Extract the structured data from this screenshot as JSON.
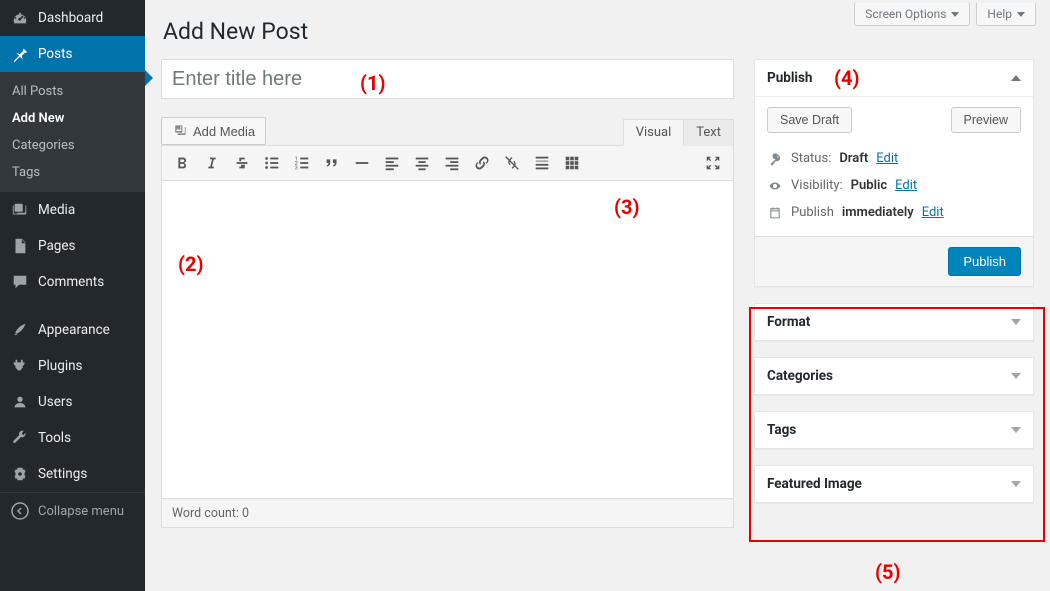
{
  "screen_options": {
    "label": "Screen Options",
    "help_label": "Help"
  },
  "page": {
    "title": "Add New Post"
  },
  "sidebar": {
    "items": [
      {
        "label": "Dashboard"
      },
      {
        "label": "Posts"
      },
      {
        "label": "Media"
      },
      {
        "label": "Pages"
      },
      {
        "label": "Comments"
      },
      {
        "label": "Appearance"
      },
      {
        "label": "Plugins"
      },
      {
        "label": "Users"
      },
      {
        "label": "Tools"
      },
      {
        "label": "Settings"
      }
    ],
    "posts_submenu": [
      {
        "label": "All Posts"
      },
      {
        "label": "Add New"
      },
      {
        "label": "Categories"
      },
      {
        "label": "Tags"
      }
    ],
    "collapse_label": "Collapse menu"
  },
  "editor": {
    "title_placeholder": "Enter title here",
    "add_media_label": "Add Media",
    "tabs": {
      "visual": "Visual",
      "text": "Text"
    },
    "word_count_label": "Word count: 0"
  },
  "publish": {
    "title": "Publish",
    "save_draft": "Save Draft",
    "preview": "Preview",
    "status_label": "Status:",
    "status_value": "Draft",
    "visibility_label": "Visibility:",
    "visibility_value": "Public",
    "schedule_label": "Publish",
    "schedule_value": "immediately",
    "edit_label": "Edit",
    "publish_button": "Publish"
  },
  "meta_boxes": {
    "format": "Format",
    "categories": "Categories",
    "tags": "Tags",
    "featured_image": "Featured Image"
  },
  "annotations": {
    "a1": "(1)",
    "a2": "(2)",
    "a3": "(3)",
    "a4": "(4)",
    "a5": "(5)"
  }
}
